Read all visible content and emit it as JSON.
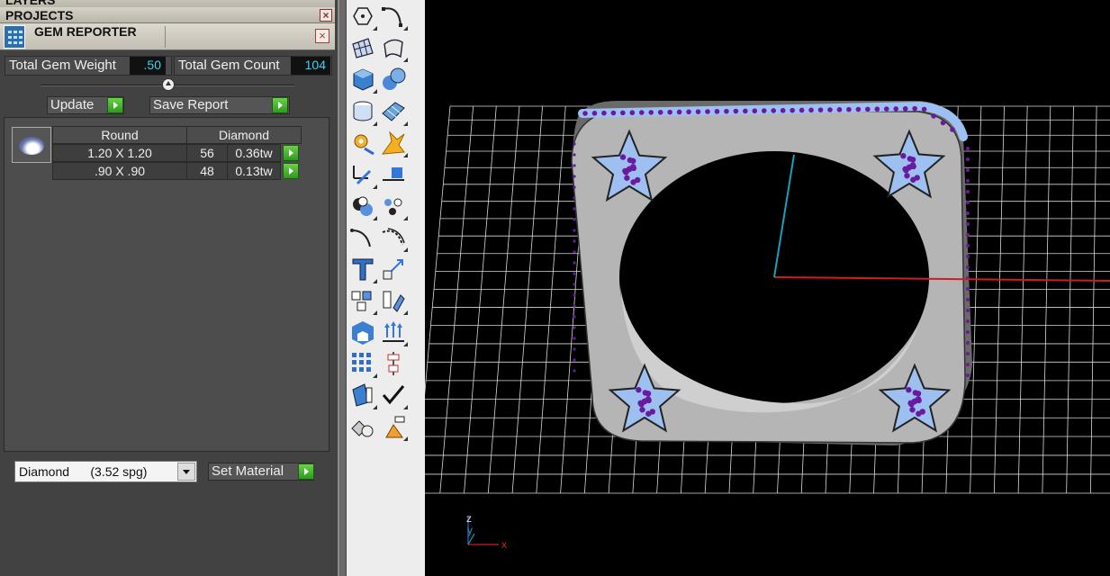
{
  "panels": {
    "layers_title": "LAYERS",
    "projects_title": "PROJECTS",
    "close_glyph": "×"
  },
  "gem_reporter": {
    "title": "GEM REPORTER",
    "total_weight_label": "Total Gem Weight",
    "total_weight_value": ".50",
    "total_count_label": "Total Gem Count",
    "total_count_value": "104",
    "update_label": "Update",
    "save_report_label": "Save Report",
    "table": {
      "header": {
        "shape": "Round",
        "material": "Diamond"
      },
      "rows": [
        {
          "size": "1.20 X 1.20",
          "count": "56",
          "weight": "0.36tw"
        },
        {
          "size": ".90 X .90",
          "count": "48",
          "weight": "0.13tw"
        }
      ]
    },
    "material_select": "Diamond      (3.52 spg)",
    "set_material_label": "Set Material"
  },
  "toolbar": {
    "tools": [
      "point-icon",
      "curve-icon",
      "surface-grid-icon",
      "loft-surface-icon",
      "box-icon",
      "spheres-icon",
      "cylinder-icon",
      "patch-icon",
      "gear-edit-icon",
      "explode-icon",
      "trim-icon",
      "split-icon",
      "boolean-icon",
      "group-icon",
      "fillet-icon",
      "offset-curve-icon",
      "text-icon",
      "scale-icon",
      "array-icon",
      "mirror-icon",
      "solid-icon",
      "extrude-up-icon",
      "grid-array-icon",
      "align-icon",
      "panel-icon",
      "check-icon",
      "render-shapes-icon",
      "material-icon"
    ]
  },
  "viewport": {
    "axis_z": "z",
    "axis_y": "y",
    "axis_x": "x",
    "colors": {
      "grid": "#d8d8d8",
      "ring": "#b5b5b5",
      "gem": "#9ec0f0",
      "prong": "#6a1aa0",
      "x_axis": "#cc2020",
      "y_axis": "#1aa0b8"
    }
  }
}
